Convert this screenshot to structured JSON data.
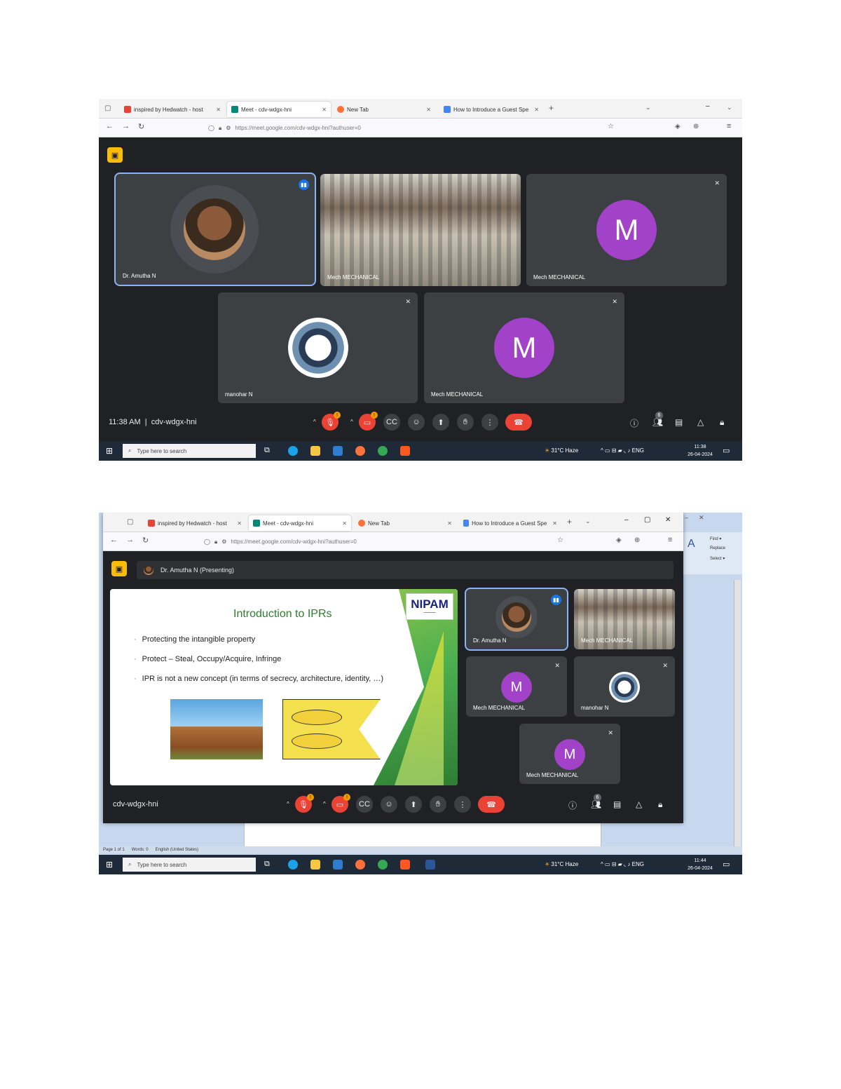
{
  "screenshot1": {
    "tabs": [
      {
        "label": "inspired by Hedwatch - host",
        "icon": "gmail-icon"
      },
      {
        "label": "Meet - cdv-wdgx-hni",
        "icon": "meet-icon",
        "active": true
      },
      {
        "label": "New Tab",
        "icon": "firefox-icon"
      },
      {
        "label": "How to Introduce a Guest Spe",
        "icon": "page-icon"
      }
    ],
    "url": "https://meet.google.com/cdv-wdgx-hni?authuser=0",
    "participants": [
      {
        "name": "Dr. Amutha N",
        "type": "photo",
        "speaking": true
      },
      {
        "name": "Mech MECHANICAL",
        "type": "video"
      },
      {
        "name": "Mech MECHANICAL",
        "type": "letter",
        "letter": "M"
      },
      {
        "name": "manohar N",
        "type": "logo"
      },
      {
        "name": "Mech MECHANICAL",
        "type": "letter",
        "letter": "M"
      }
    ],
    "time": "11:38 AM",
    "meeting_code": "cdv-wdgx-hni",
    "people_count": "6",
    "taskbar": {
      "search_placeholder": "Type here to search",
      "weather": "31°C Haze",
      "lang": "ENG",
      "clock_time": "11:38",
      "clock_date": "26-04-2024"
    }
  },
  "screenshot2": {
    "tabs": [
      {
        "label": "inspired by Hedwatch - host",
        "icon": "gmail-icon"
      },
      {
        "label": "Meet - cdv-wdgx-hni",
        "icon": "meet-icon",
        "active": true
      },
      {
        "label": "New Tab",
        "icon": "firefox-icon"
      },
      {
        "label": "How to Introduce a Guest Spe",
        "icon": "page-icon"
      }
    ],
    "url": "https://meet.google.com/cdv-wdgx-hni?authuser=0",
    "presenting_label": "Dr. Amutha N (Presenting)",
    "slide": {
      "title": "Introduction to IPRs",
      "logo": "NIPAM",
      "bullets": [
        "Protecting the intangible property",
        "Protect – Steal, Occupy/Acquire, Infringe",
        "IPR is not a new concept (in terms of secrecy, architecture, identity, …)"
      ]
    },
    "participants": [
      {
        "name": "Dr. Amutha N",
        "type": "photo",
        "speaking": true
      },
      {
        "name": "Mech MECHANICAL",
        "type": "video"
      },
      {
        "name": "Mech MECHANICAL",
        "type": "letter",
        "letter": "M"
      },
      {
        "name": "manohar N",
        "type": "logo"
      },
      {
        "name": "Mech MECHANICAL",
        "type": "letter",
        "letter": "M"
      }
    ],
    "meeting_code": "cdv-wdgx-hni",
    "people_count": "6",
    "word_status": {
      "page": "Page 1 of 1",
      "words": "Words: 0",
      "language": "English (United States)"
    },
    "taskbar": {
      "search_placeholder": "Type here to search",
      "weather": "31°C Haze",
      "lang": "ENG",
      "clock_time": "11:44",
      "clock_date": "26-04-2024"
    }
  }
}
